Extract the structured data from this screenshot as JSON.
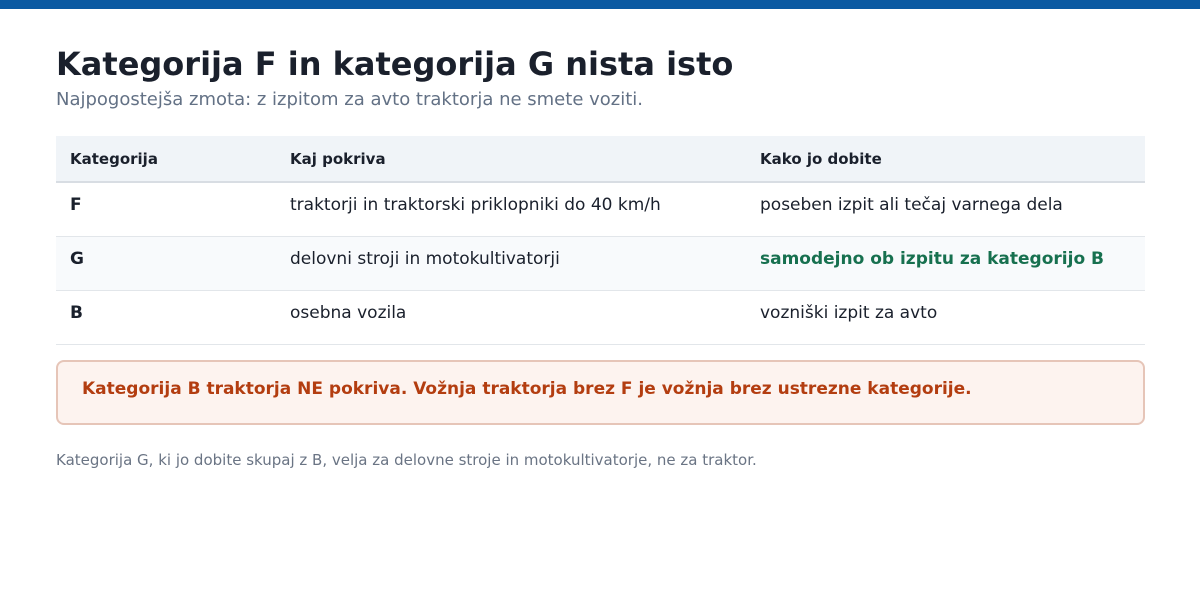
{
  "title": "Kategorija F in kategorija G nista isto",
  "subtitle": "Najpogostejša zmota: z izpitom za avto traktorja ne smete voziti.",
  "table": {
    "headers": [
      "Kategorija",
      "Kaj pokriva",
      "Kako jo dobite"
    ],
    "rows": [
      [
        "F",
        "traktorji in traktorski priklopniki do 40 km/h",
        "poseben izpit ali tečaj varnega dela"
      ],
      [
        "G",
        "delovni stroji in motokultivatorji",
        "samodejno ob izpitu za kategorijo B"
      ],
      [
        "B",
        "osebna vozila",
        "vozniški izpit za avto"
      ]
    ]
  },
  "warning": "Kategorija B traktorja NE pokriva. Vožnja traktorja brez F je vožnja brez ustrezne kategorije.",
  "footnote": "Kategorija G, ki jo dobite skupaj z B, velja za delovne stroje in motokultivatorje, ne za traktor.",
  "colors": {
    "top_bar": "#0b5aa2",
    "highlight": "#17704f",
    "warning_text": "#b33d10",
    "warning_bg": "#fdf3ef"
  }
}
